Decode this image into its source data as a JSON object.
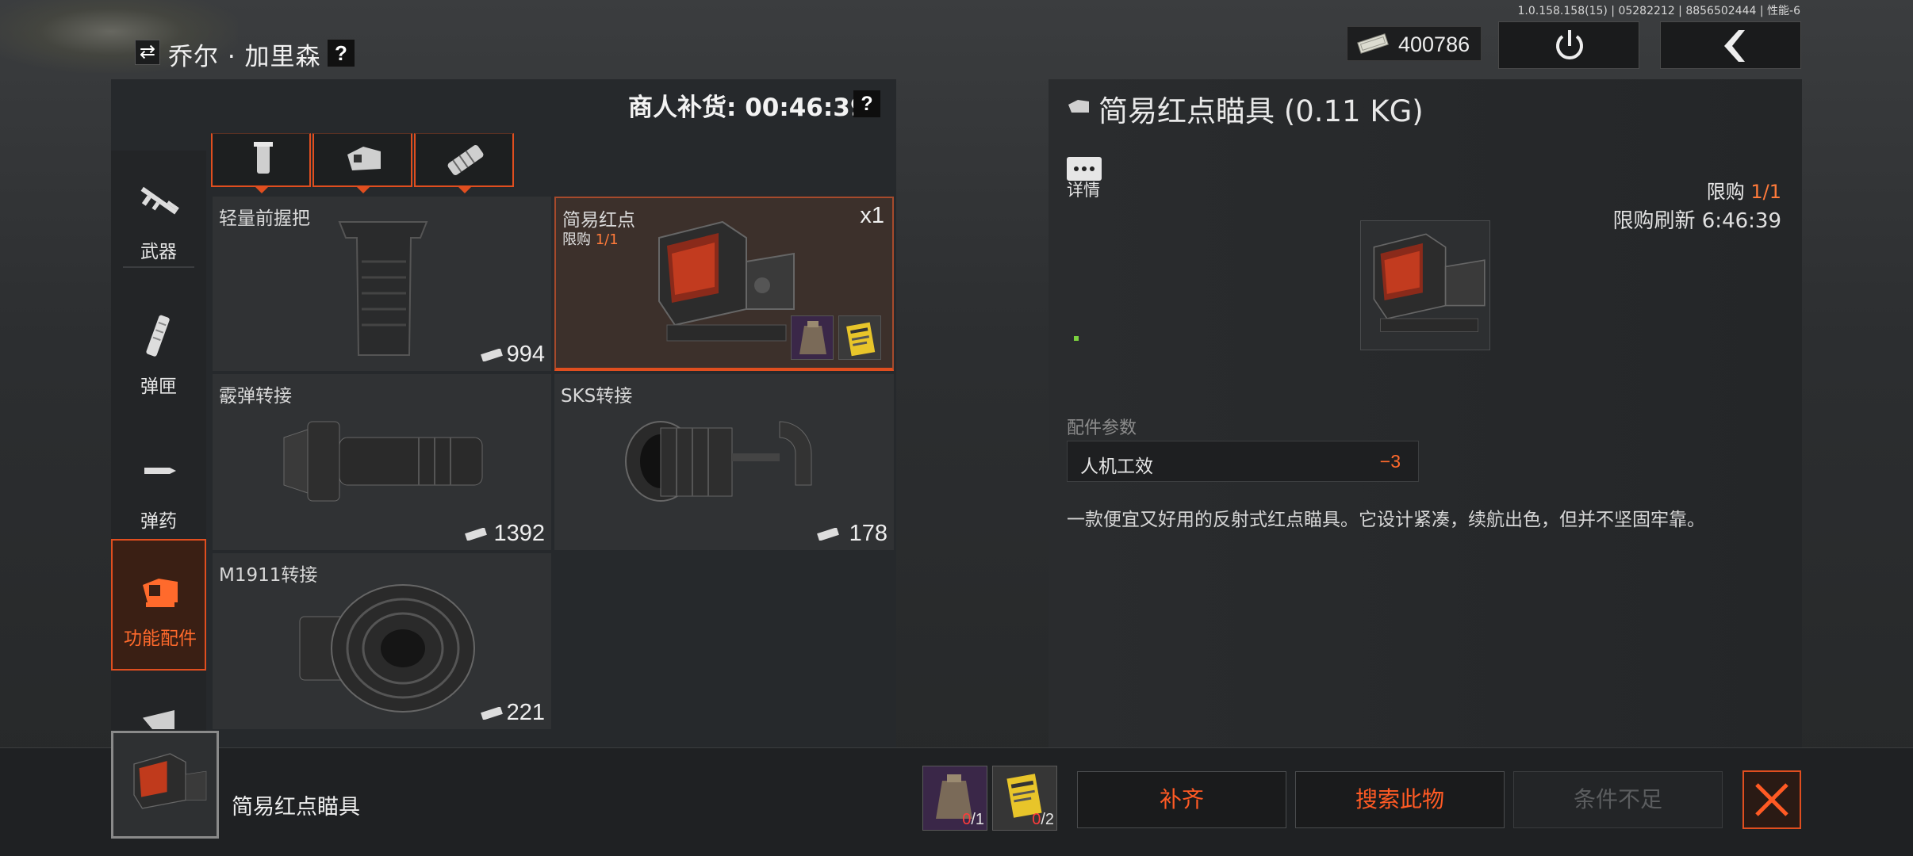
{
  "version": "1.0.158.158(15) | 05282212 | 8856502444 | 性能-6",
  "header": {
    "trader_name": "乔尔 · 加里森",
    "help": "?",
    "money": "400786"
  },
  "restock": {
    "label": "商人补货: 00:46:39",
    "help": "?"
  },
  "categories": [
    {
      "label": "武器",
      "icon": "rifle-icon"
    },
    {
      "label": "弹匣",
      "icon": "magazine-icon"
    },
    {
      "label": "弹药",
      "icon": "bullet-icon"
    },
    {
      "label": "功能配件",
      "icon": "red-dot-sight-icon",
      "active": true
    }
  ],
  "sub_tabs": [
    "grip-icon",
    "sight-icon",
    "muzzle-icon"
  ],
  "items": [
    {
      "name": "轻量前握把",
      "price": "994"
    },
    {
      "name": "简易红点",
      "limit_label": "限购",
      "limit_value": "1/1",
      "qty": "x1",
      "selected": true
    },
    {
      "name": "霰弹转接",
      "price": "1392"
    },
    {
      "name": "SKS转接",
      "price": "178"
    },
    {
      "name": "M1911转接",
      "price": "221"
    }
  ],
  "detail": {
    "title": "简易红点瞄具 (0.11 KG)",
    "details_label": "详情",
    "limit_label": "限购",
    "limit_value": "1/1",
    "refresh": "限购刷新 6:46:39",
    "param_header": "配件参数",
    "param_name": "人机工效",
    "param_value": "−3",
    "description": "一款便宜又好用的反射式红点瞄具。它设计紧凑，续航出色，但并不坚固牢靠。"
  },
  "bottom": {
    "item_name": "简易红点瞄具",
    "req1_have": "0",
    "req1_need": "/1",
    "req2_have": "0",
    "req2_need": "/2",
    "btn_fill": "补齐",
    "btn_search": "搜索此物",
    "btn_cond": "条件不足"
  },
  "colors": {
    "accent": "#e04e1f",
    "accent_text": "#ff6a2c",
    "panel": "#26292c"
  }
}
